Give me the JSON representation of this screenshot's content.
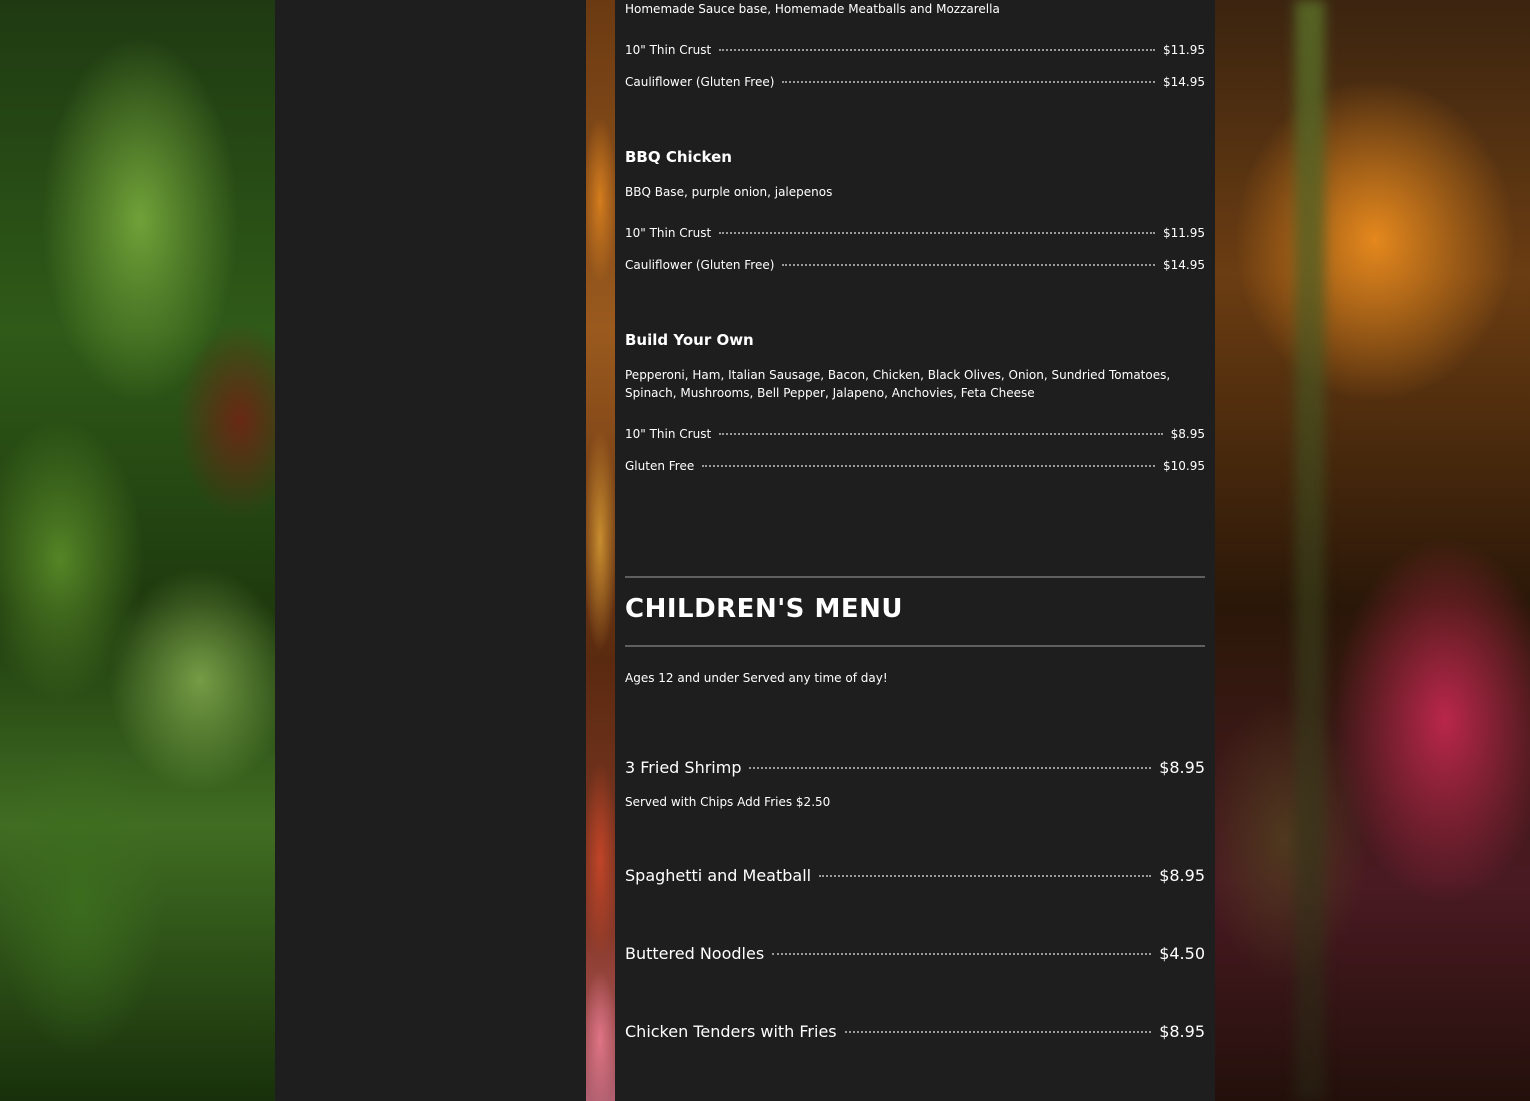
{
  "menu": {
    "meatball_pizza": {
      "description": "Homemade Sauce base, Homemade Meatballs and Mozzarella",
      "options": [
        {
          "name": "10\" Thin Crust",
          "price": "$11.95"
        },
        {
          "name": "Cauliflower (Gluten Free)",
          "price": "$14.95"
        }
      ]
    },
    "bbq_chicken": {
      "title": "BBQ Chicken",
      "description": "BBQ Base, purple onion, jalepenos",
      "options": [
        {
          "name": "10\" Thin Crust",
          "price": "$11.95"
        },
        {
          "name": "Cauliflower (Gluten Free)",
          "price": "$14.95"
        }
      ]
    },
    "build_your_own": {
      "title": "Build Your Own",
      "description": "Pepperoni, Ham, Italian Sausage, Bacon, Chicken, Black Olives, Onion, Sundried Tomatoes, Spinach, Mushrooms, Bell Pepper, Jalapeno, Anchovies, Feta Cheese",
      "options": [
        {
          "name": "10\" Thin Crust",
          "price": "$8.95"
        },
        {
          "name": "Gluten Free",
          "price": "$10.95"
        }
      ]
    }
  },
  "children": {
    "title": "CHILDREN'S MENU",
    "note": "Ages 12 and under Served any time of day!",
    "items": [
      {
        "name": "3 Fried Shrimp",
        "price": "$8.95",
        "description": "Served with Chips Add Fries $2.50"
      },
      {
        "name": "Spaghetti and Meatball",
        "price": "$8.95"
      },
      {
        "name": "Buttered Noodles",
        "price": "$4.50"
      },
      {
        "name": "Chicken Tenders with Fries",
        "price": "$8.95"
      }
    ]
  }
}
